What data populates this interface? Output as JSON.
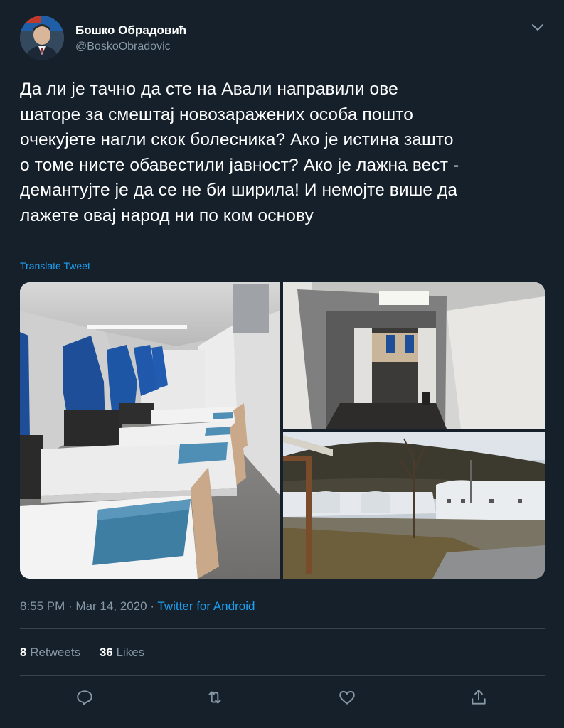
{
  "author": {
    "name": "Бошко Обрадовић",
    "handle": "@BoskoObradovic"
  },
  "tweet": {
    "text_lines": [
      "Да ли је тачно да сте на Авали направили ове",
      "шаторе за смештај новозаражених особа пошто",
      "очекујете нагли скок болесника? Ако је истина зашто",
      "о томе нисте обавестили јавност? Ако је лажна вест -",
      "демантујте је да се не би ширила! И немојте више да",
      "лажете овај народ ни по ком основу"
    ],
    "translate_label": "Translate Tweet"
  },
  "meta": {
    "time": "8:55 PM",
    "separator1": " · ",
    "date": "Mar 14, 2020",
    "separator2": " · ",
    "source": "Twitter for Android"
  },
  "stats": {
    "retweets_count": "8",
    "retweets_label": "Retweets",
    "likes_count": "36",
    "likes_label": "Likes"
  },
  "icons": {
    "menu": "chevron-down-icon",
    "reply": "reply-icon",
    "retweet": "retweet-icon",
    "like": "heart-icon",
    "share": "share-icon"
  },
  "colors": {
    "background": "#15202b",
    "text": "#ffffff",
    "secondary": "#8899a6",
    "accent": "#1da1f2",
    "divider": "#38444d"
  }
}
